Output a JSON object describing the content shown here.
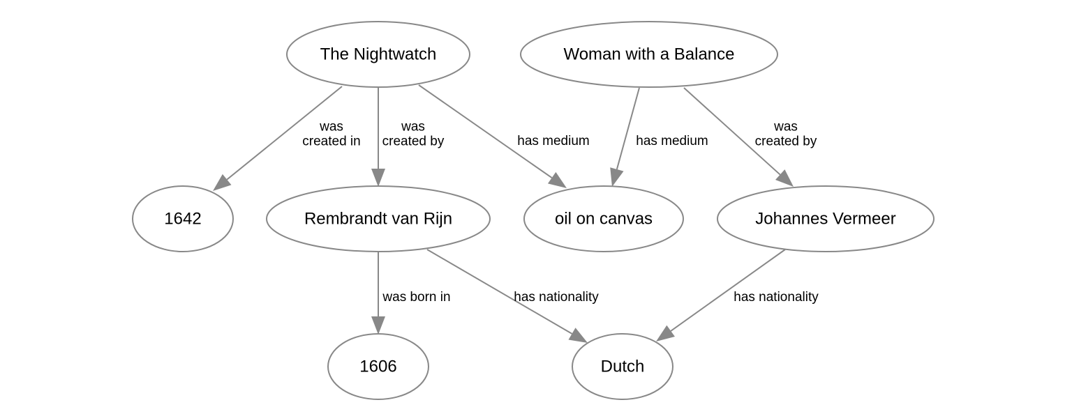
{
  "colors": {
    "edge": "#888888",
    "node_stroke": "#888888",
    "text": "#000000"
  },
  "nodes": [
    {
      "id": "nightwatch",
      "label": "The Nightwatch"
    },
    {
      "id": "woman",
      "label": "Woman with a Balance"
    },
    {
      "id": "y1642",
      "label": "1642"
    },
    {
      "id": "rembrandt",
      "label": "Rembrandt van Rijn"
    },
    {
      "id": "oil",
      "label": "oil on canvas"
    },
    {
      "id": "vermeer",
      "label": "Johannes Vermeer"
    },
    {
      "id": "y1606",
      "label": "1606"
    },
    {
      "id": "dutch",
      "label": "Dutch"
    }
  ],
  "edges": [
    {
      "from": "nightwatch",
      "to": "y1642",
      "label": [
        "was",
        "created in"
      ]
    },
    {
      "from": "nightwatch",
      "to": "rembrandt",
      "label": [
        "was",
        "created by"
      ]
    },
    {
      "from": "nightwatch",
      "to": "oil",
      "label": [
        "has medium"
      ]
    },
    {
      "from": "woman",
      "to": "oil",
      "label": [
        "has medium"
      ]
    },
    {
      "from": "woman",
      "to": "vermeer",
      "label": [
        "was",
        "created by"
      ]
    },
    {
      "from": "rembrandt",
      "to": "y1606",
      "label": [
        "was born in"
      ]
    },
    {
      "from": "rembrandt",
      "to": "dutch",
      "label": [
        "has nationality"
      ]
    },
    {
      "from": "vermeer",
      "to": "dutch",
      "label": [
        "has nationality"
      ]
    }
  ]
}
